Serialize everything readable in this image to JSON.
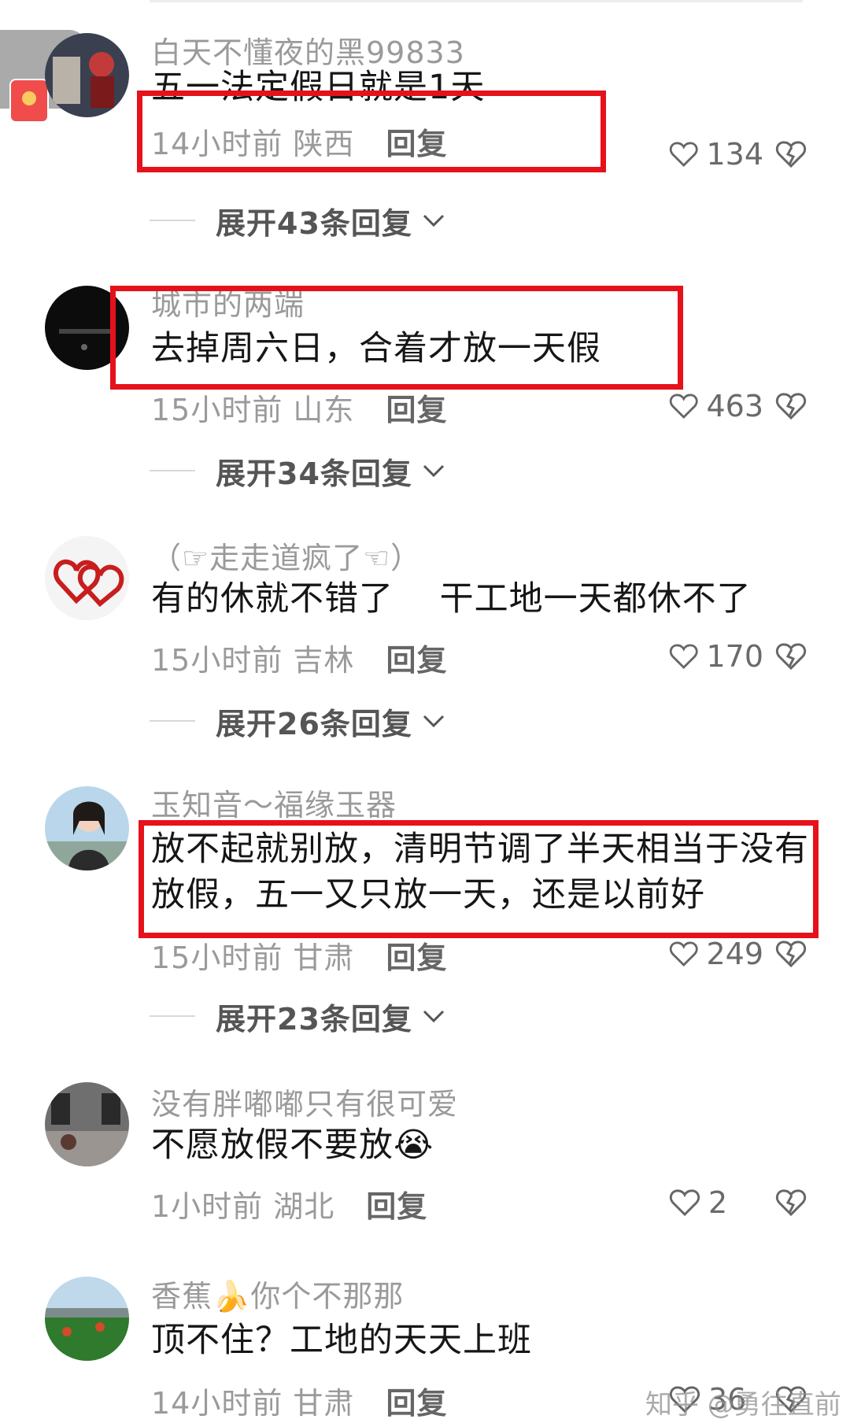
{
  "comments": [
    {
      "username": "白天不懂夜的黑99833",
      "text": "五一法定假日就是1天",
      "time_location": "14小时前 陕西",
      "reply_label": "回复",
      "likes": "134",
      "expand_label": "展开43条回复"
    },
    {
      "username": "城市的两端",
      "text": "去掉周六日，合着才放一天假",
      "time_location": "15小时前 山东",
      "reply_label": "回复",
      "likes": "463",
      "expand_label": "展开34条回复"
    },
    {
      "username": "（☞走走道疯了☜）",
      "text": "有的休就不错了　 干工地一天都休不了",
      "time_location": "15小时前 吉林",
      "reply_label": "回复",
      "likes": "170",
      "expand_label": "展开26条回复"
    },
    {
      "username": "玉知音～福缘玉器",
      "text": "放不起就别放，清明节调了半天相当于没有放假，五一又只放一天，还是以前好",
      "time_location": "15小时前 甘肃",
      "reply_label": "回复",
      "likes": "249",
      "expand_label": "展开23条回复"
    },
    {
      "username": "没有胖嘟嘟只有很可爱",
      "text": "不愿放假不要放😭",
      "time_location": "1小时前 湖北",
      "reply_label": "回复",
      "likes": "2"
    },
    {
      "username": "香蕉🍌你个不那那",
      "text": "顶不住？工地的天天上班",
      "time_location": "14小时前 甘肃",
      "reply_label": "回复",
      "likes": "36"
    }
  ],
  "watermark": "知乎 @勇往直前",
  "icons": {
    "like": "heart-icon",
    "dislike": "broken-heart-icon",
    "expand": "chevron-down-icon",
    "float": "red-packet-icon"
  },
  "colors": {
    "highlight_box": "#e6121b",
    "meta_text": "#9a9a9a",
    "body_text": "#161616"
  }
}
